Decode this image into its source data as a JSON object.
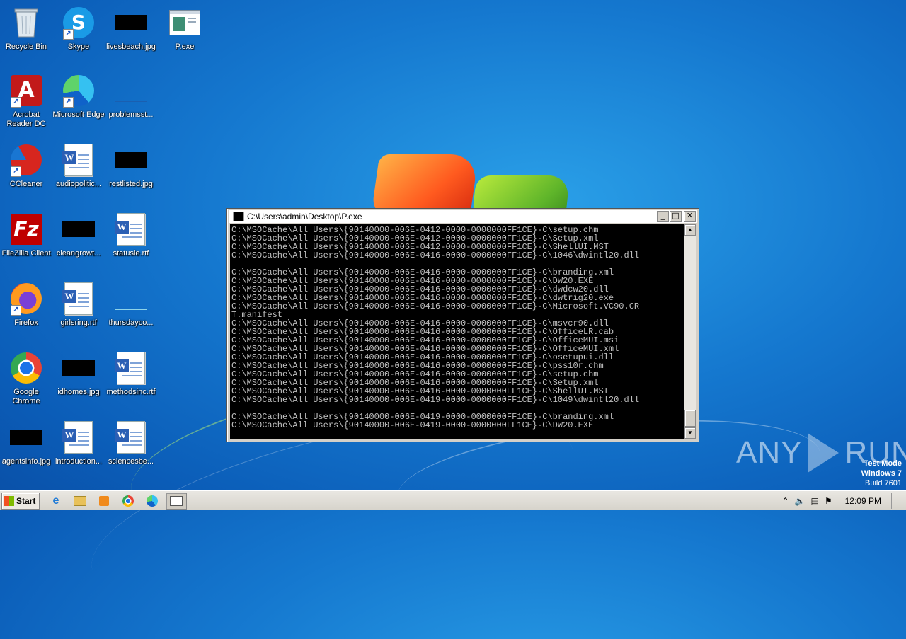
{
  "desktop": {
    "icons": [
      {
        "label": "Recycle Bin",
        "icon": "recycle-bin-icon"
      },
      {
        "label": "Skype",
        "icon": "skype-icon"
      },
      {
        "label": "livesbeach.jpg",
        "icon": "image-file-icon"
      },
      {
        "label": "P.exe",
        "icon": "exe-file-icon"
      },
      {
        "label": "Acrobat Reader DC",
        "icon": "acrobat-icon"
      },
      {
        "label": "Microsoft Edge",
        "icon": "edge-icon"
      },
      {
        "label": "problemsst...",
        "icon": "file-icon"
      },
      {
        "label": "CCleaner",
        "icon": "ccleaner-icon"
      },
      {
        "label": "audiopolitic...",
        "icon": "word-doc-icon"
      },
      {
        "label": "restlisted.jpg",
        "icon": "image-file-icon"
      },
      {
        "label": "FileZilla Client",
        "icon": "filezilla-icon"
      },
      {
        "label": "cleangrowt...",
        "icon": "image-file-icon"
      },
      {
        "label": "statusle.rtf",
        "icon": "word-doc-icon"
      },
      {
        "label": "Firefox",
        "icon": "firefox-icon"
      },
      {
        "label": "girlsring.rtf",
        "icon": "word-doc-icon"
      },
      {
        "label": "thursdayco...",
        "icon": "file-icon"
      },
      {
        "label": "Google Chrome",
        "icon": "chrome-icon"
      },
      {
        "label": "idhomes.jpg",
        "icon": "image-file-icon"
      },
      {
        "label": "methodsinc.rtf",
        "icon": "word-doc-icon"
      },
      {
        "label": "agentsinfo.jpg",
        "icon": "image-file-icon"
      },
      {
        "label": "introduction...",
        "icon": "word-doc-icon"
      },
      {
        "label": "sciencesbe...",
        "icon": "word-doc-icon"
      }
    ]
  },
  "console_window": {
    "title": "C:\\Users\\admin\\Desktop\\P.exe",
    "buttons": {
      "minimize": "_",
      "maximize": "□",
      "close": "✕"
    },
    "lines": [
      "C:\\MSOCache\\All Users\\{90140000-006E-0412-0000-0000000FF1CE}-C\\setup.chm",
      "C:\\MSOCache\\All Users\\{90140000-006E-0412-0000-0000000FF1CE}-C\\Setup.xml",
      "C:\\MSOCache\\All Users\\{90140000-006E-0412-0000-0000000FF1CE}-C\\ShellUI.MST",
      "C:\\MSOCache\\All Users\\{90140000-006E-0416-0000-0000000FF1CE}-C\\1046\\dwintl20.dll",
      "",
      "C:\\MSOCache\\All Users\\{90140000-006E-0416-0000-0000000FF1CE}-C\\branding.xml",
      "C:\\MSOCache\\All Users\\{90140000-006E-0416-0000-0000000FF1CE}-C\\DW20.EXE",
      "C:\\MSOCache\\All Users\\{90140000-006E-0416-0000-0000000FF1CE}-C\\dwdcw20.dll",
      "C:\\MSOCache\\All Users\\{90140000-006E-0416-0000-0000000FF1CE}-C\\dwtrig20.exe",
      "C:\\MSOCache\\All Users\\{90140000-006E-0416-0000-0000000FF1CE}-C\\Microsoft.VC90.CR",
      "T.manifest",
      "C:\\MSOCache\\All Users\\{90140000-006E-0416-0000-0000000FF1CE}-C\\msvcr90.dll",
      "C:\\MSOCache\\All Users\\{90140000-006E-0416-0000-0000000FF1CE}-C\\OfficeLR.cab",
      "C:\\MSOCache\\All Users\\{90140000-006E-0416-0000-0000000FF1CE}-C\\OfficeMUI.msi",
      "C:\\MSOCache\\All Users\\{90140000-006E-0416-0000-0000000FF1CE}-C\\OfficeMUI.xml",
      "C:\\MSOCache\\All Users\\{90140000-006E-0416-0000-0000000FF1CE}-C\\osetupui.dll",
      "C:\\MSOCache\\All Users\\{90140000-006E-0416-0000-0000000FF1CE}-C\\pss10r.chm",
      "C:\\MSOCache\\All Users\\{90140000-006E-0416-0000-0000000FF1CE}-C\\setup.chm",
      "C:\\MSOCache\\All Users\\{90140000-006E-0416-0000-0000000FF1CE}-C\\Setup.xml",
      "C:\\MSOCache\\All Users\\{90140000-006E-0416-0000-0000000FF1CE}-C\\ShellUI.MST",
      "C:\\MSOCache\\All Users\\{90140000-006E-0419-0000-0000000FF1CE}-C\\1049\\dwintl20.dll",
      "",
      "C:\\MSOCache\\All Users\\{90140000-006E-0419-0000-0000000FF1CE}-C\\branding.xml",
      "C:\\MSOCache\\All Users\\{90140000-006E-0419-0000-0000000FF1CE}-C\\DW20.EXE"
    ]
  },
  "watermark": {
    "brand_left": "ANY",
    "brand_right": "RUN",
    "line1": "Test Mode",
    "line2": "Windows 7",
    "line3": "Build 7601"
  },
  "taskbar": {
    "start_label": "Start",
    "clock": "12:09 PM"
  }
}
